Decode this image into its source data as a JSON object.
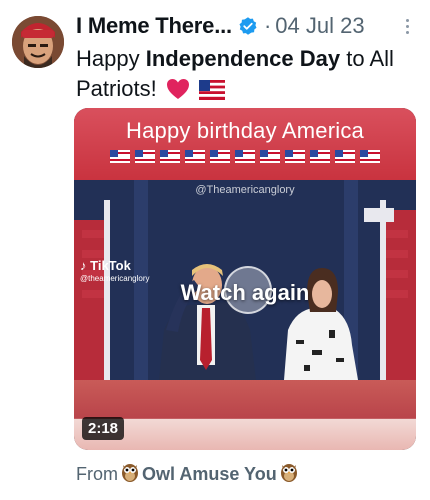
{
  "post": {
    "display_name": "I Meme There...",
    "separator": "·",
    "date": "04 Jul 23",
    "text_before": "Happy ",
    "text_bold": "Independence Day",
    "text_after": " to All Patriots!",
    "emoji": [
      "heart-icon",
      "us-flag-icon"
    ]
  },
  "media": {
    "banner_text": "Happy birthday America",
    "watermark": "@Theamericanglory",
    "tiktok_label": "TikTok",
    "tiktok_handle": "@theamericanglory",
    "overlay_text": "Watch again",
    "duration": "2:18"
  },
  "source": {
    "prefix": "From",
    "name": "Owl Amuse You"
  },
  "colors": {
    "verified": "#1d9bf0",
    "banner_red": "#d9505d",
    "text_secondary": "#536471"
  }
}
